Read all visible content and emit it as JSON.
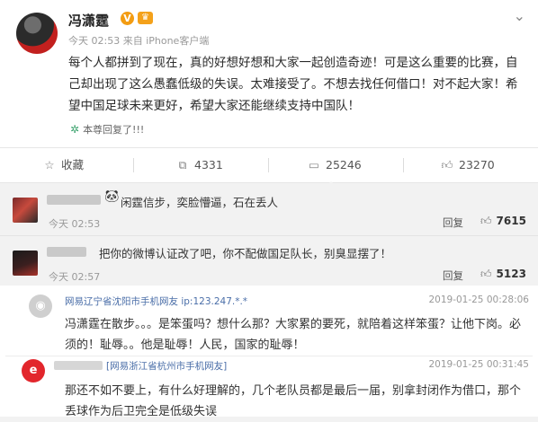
{
  "post": {
    "author": "冯潇霆",
    "verify_badge": "V",
    "meta": "今天 02:53 来自 iPhone客户端",
    "content": "每个人都拼到了现在，真的好想好想和大家一起创造奇迹！可是这么重要的比赛，自己却出现了这么愚蠢低级的失误。太难接受了。不想去找任何借口！对不起大家！希望中国足球未来更好，希望大家还能继续支持中国队！",
    "replied_label": "本尊回复了!!!",
    "actions": {
      "favorite_label": "收藏",
      "repost_count": "4331",
      "comment_count": "25246",
      "like_count": "23270"
    }
  },
  "comments": [
    {
      "text": "闲霆信步，奕脸懵逼，石在丢人",
      "time": "今天 02:53",
      "reply_label": "回复",
      "likes": "7615"
    },
    {
      "text": "把你的微博认证改了吧，你不配做国足队长，别臭显摆了！",
      "time": "今天 02:57",
      "reply_label": "回复",
      "likes": "5123"
    }
  ],
  "netease": [
    {
      "user": "网易辽宁省沈阳市手机网友 ip:123.247.*.*",
      "date": "2019-01-25 00:28:06",
      "text": "冯潇霆在散步。。。是笨蛋吗？想什么那？大家累的要死，就陪着这样笨蛋？让他下岗。必须的！耻辱。。他是耻辱！人民，国家的耻辱！"
    },
    {
      "user": "[网易浙江省杭州市手机网友]",
      "date": "2019-01-25 00:31:45",
      "text": "那还不如不要上，有什么好理解的，几个老队员都是最后一届，别拿封闭作为借口，那个丢球作为后卫完全是低级失误"
    }
  ],
  "colors": {
    "accent_orange": "#f39c12",
    "netease_blue": "#4a6ea8",
    "netease_red": "#e2262c"
  }
}
